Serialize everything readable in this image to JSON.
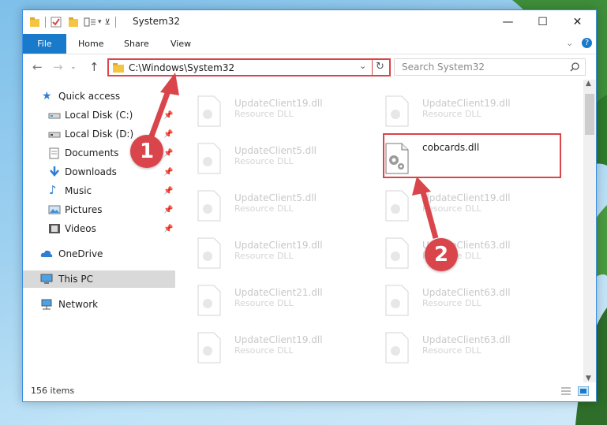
{
  "window": {
    "title": "System32"
  },
  "ribbon": {
    "tabs": [
      "File",
      "Home",
      "Share",
      "View"
    ]
  },
  "address": {
    "path": "C:\\Windows\\System32"
  },
  "search": {
    "placeholder": "Search System32"
  },
  "navigation": {
    "items": [
      {
        "label": "Quick access",
        "icon": "star-icon",
        "pinned": false
      },
      {
        "label": "Local Disk (C:)",
        "icon": "drive-icon",
        "pinned": true
      },
      {
        "label": "Local Disk (D:)",
        "icon": "drive-icon",
        "pinned": true
      },
      {
        "label": "Documents",
        "icon": "documents-icon",
        "pinned": true
      },
      {
        "label": "Downloads",
        "icon": "download-icon",
        "pinned": true
      },
      {
        "label": "Music",
        "icon": "music-icon",
        "pinned": true
      },
      {
        "label": "Pictures",
        "icon": "pictures-icon",
        "pinned": true
      },
      {
        "label": "Videos",
        "icon": "videos-icon",
        "pinned": true
      },
      {
        "label": "OneDrive",
        "icon": "cloud-icon",
        "pinned": false
      },
      {
        "label": "This PC",
        "icon": "computer-icon",
        "pinned": false,
        "selected": true
      },
      {
        "label": "Network",
        "icon": "network-icon",
        "pinned": false
      }
    ]
  },
  "files": [
    {
      "name": "UpdateClient19.dll",
      "type": "Resource DLL"
    },
    {
      "name": "UpdateClient19.dll",
      "type": "Resource DLL"
    },
    {
      "name": "UpdateClient5.dll",
      "type": "Resource DLL"
    },
    {
      "name": "cobcards.dll",
      "type": ""
    },
    {
      "name": "UpdateClient5.dll",
      "type": "Resource DLL"
    },
    {
      "name": "UpdateClient19.dll",
      "type": "Resource DLL"
    },
    {
      "name": "UpdateClient19.dll",
      "type": "Resource DLL"
    },
    {
      "name": "UpdateClient63.dll",
      "type": "Resource DLL"
    },
    {
      "name": "UpdateClient21.dll",
      "type": "Resource DLL"
    },
    {
      "name": "UpdateClient63.dll",
      "type": "Resource DLL"
    },
    {
      "name": "UpdateClient19.dll",
      "type": "Resource DLL"
    },
    {
      "name": "UpdateClient63.dll",
      "type": "Resource DLL"
    }
  ],
  "status": {
    "count": "156 items"
  },
  "annotations": {
    "step1": "1",
    "step2": "2"
  },
  "colors": {
    "accent": "#1979ca",
    "highlight": "#d9454b"
  }
}
